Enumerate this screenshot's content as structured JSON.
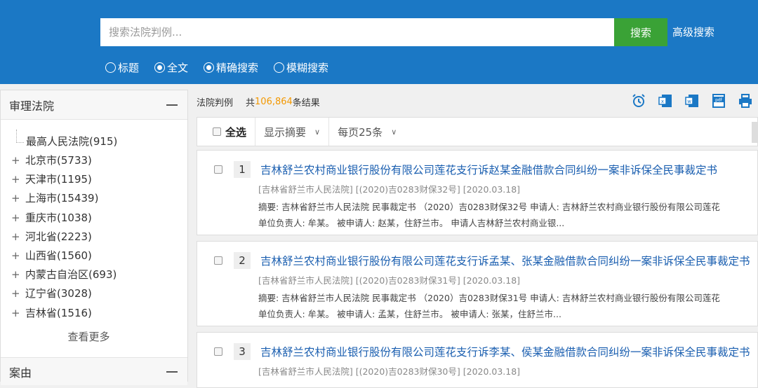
{
  "search": {
    "placeholder": "搜索法院判例...",
    "button": "搜索",
    "advanced": "高级搜索",
    "options": [
      {
        "label": "标题",
        "checked": false
      },
      {
        "label": "全文",
        "checked": true
      },
      {
        "label": "精确搜索",
        "checked": true
      },
      {
        "label": "模糊搜索",
        "checked": false
      }
    ]
  },
  "sidebar": {
    "section_title": "审理法院",
    "top_item": "最高人民法院(915)",
    "items": [
      "北京市(5733)",
      "天津市(1195)",
      "上海市(15439)",
      "重庆市(1038)",
      "河北省(2223)",
      "山西省(1560)",
      "内蒙古自治区(693)",
      "辽宁省(3028)",
      "吉林省(1516)"
    ],
    "more": "查看更多",
    "section2_title": "案由"
  },
  "results": {
    "label": "法院判例",
    "count_prefix": "共 ",
    "count": "106,864",
    "count_suffix": "条结果",
    "select_all": "全选",
    "summary_mode": "显示摘要",
    "page_size": "每页25条",
    "items": [
      {
        "num": "1",
        "title": "吉林舒兰农村商业银行股份有限公司莲花支行诉赵某金融借款合同纠纷一案非诉保全民事裁定书",
        "meta": "[吉林省舒兰市人民法院] [(2020)吉0283财保32号] [2020.03.18]",
        "abstract1": "摘要:  吉林省舒兰市人民法院 民事裁定书 （2020）吉0283财保32号 申请人: 吉林舒兰农村商业银行股份有限公司莲花",
        "abstract2": "单位负责人: 牟某。 被申请人: 赵某，住舒兰市。 申请人吉林舒兰农村商业银..."
      },
      {
        "num": "2",
        "title": "吉林舒兰农村商业银行股份有限公司莲花支行诉孟某、张某金融借款合同纠纷一案非诉保全民事裁定书",
        "meta": "[吉林省舒兰市人民法院] [(2020)吉0283财保31号] [2020.03.18]",
        "abstract1": "摘要:  吉林省舒兰市人民法院 民事裁定书 （2020）吉0283财保31号 申请人: 吉林舒兰农村商业银行股份有限公司莲花",
        "abstract2": "单位负责人: 牟某。 被申请人: 孟某，住舒兰市。 被申请人: 张某，住舒兰市..."
      },
      {
        "num": "3",
        "title": "吉林舒兰农村商业银行股份有限公司莲花支行诉李某、侯某金融借款合同纠纷一案非诉保全民事裁定书",
        "meta": "[吉林省舒兰市人民法院] [(2020)吉0283财保30号] [2020.03.18]"
      }
    ]
  },
  "icons": [
    "alarm-clock-icon",
    "excel-icon",
    "word-icon",
    "pdf-icon",
    "printer-icon"
  ]
}
